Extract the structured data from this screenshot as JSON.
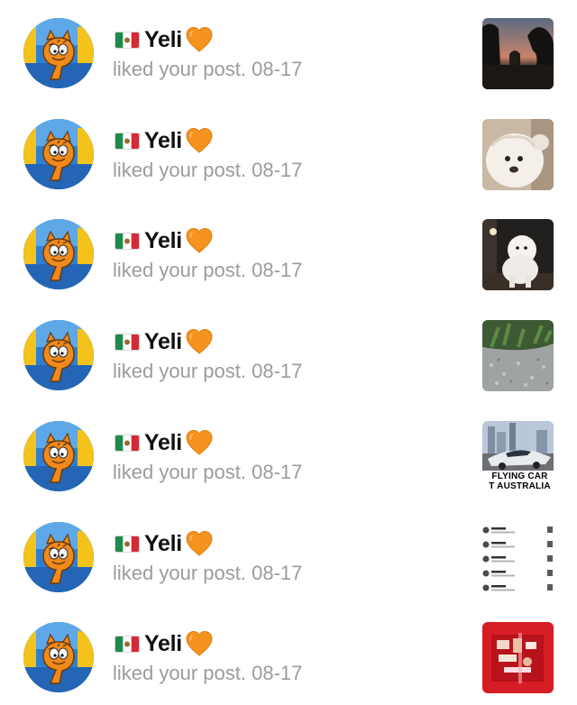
{
  "notifications": [
    {
      "flag": "mexico-flag",
      "name": "Yeli",
      "heart": "orange-heart",
      "action": "liked your post.",
      "date": "08-17",
      "thumbnail": "sunset-trees-photo"
    },
    {
      "flag": "mexico-flag",
      "name": "Yeli",
      "heart": "orange-heart",
      "action": "liked your post.",
      "date": "08-17",
      "thumbnail": "white-dog-closeup-photo"
    },
    {
      "flag": "mexico-flag",
      "name": "Yeli",
      "heart": "orange-heart",
      "action": "liked your post.",
      "date": "08-17",
      "thumbnail": "white-poodle-night-photo"
    },
    {
      "flag": "mexico-flag",
      "name": "Yeli",
      "heart": "orange-heart",
      "action": "liked your post.",
      "date": "08-17",
      "thumbnail": "gravel-plants-photo"
    },
    {
      "flag": "mexico-flag",
      "name": "Yeli",
      "heart": "orange-heart",
      "action": "liked your post.",
      "date": "08-17",
      "thumbnail": "flying-car-photo",
      "thumbnail_caption": [
        "FLYING CAR",
        "T AUSTRALIA"
      ]
    },
    {
      "flag": "mexico-flag",
      "name": "Yeli",
      "heart": "orange-heart",
      "action": "liked your post.",
      "date": "08-17",
      "thumbnail": "notification-list-screenshot"
    },
    {
      "flag": "mexico-flag",
      "name": "Yeli",
      "heart": "orange-heart",
      "action": "liked your post.",
      "date": "08-17",
      "thumbnail": "red-gift-box-photo"
    }
  ],
  "colors": {
    "background": "#ffffff",
    "name_text": "#111111",
    "secondary_text": "#9b9ba0",
    "heart": "#f6921e"
  }
}
